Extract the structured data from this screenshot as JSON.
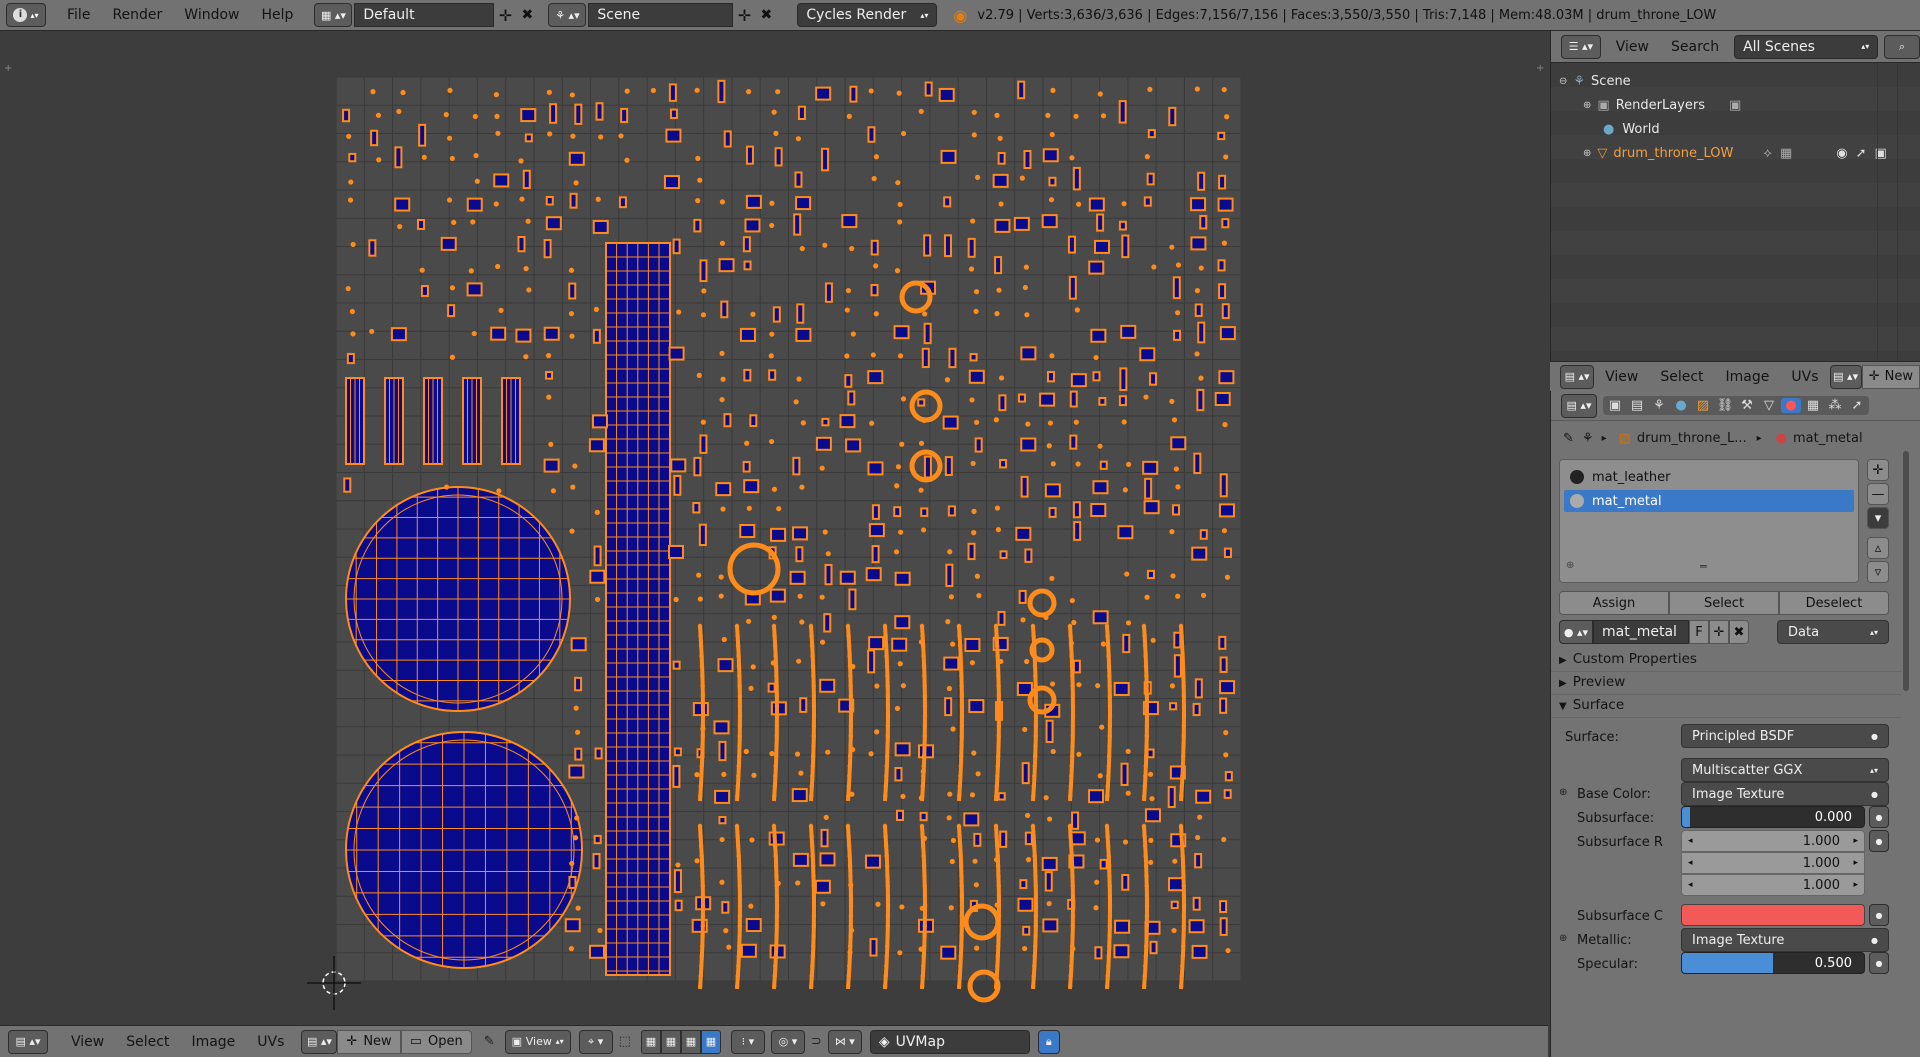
{
  "topbar": {
    "menus": [
      "File",
      "Render",
      "Window",
      "Help"
    ],
    "screen_layout": "Default",
    "scene": "Scene",
    "render_engine": "Cycles Render",
    "stats": "v2.79 | Verts:3,636/3,636 | Edges:7,156/7,156 | Faces:3,550/3,550 | Tris:7,148 | Mem:48.03M | drum_throne_LOW"
  },
  "outliner": {
    "menus": [
      "View",
      "Search"
    ],
    "display_mode": "All Scenes",
    "tree": [
      "Scene",
      "RenderLayers",
      "World",
      "drum_throne_LOW"
    ]
  },
  "image_header": {
    "menus": [
      "View",
      "Select",
      "Image",
      "UVs"
    ],
    "new_label": "New"
  },
  "properties": {
    "breadcrumb": {
      "object": "drum_throne_L...",
      "material": "mat_metal"
    },
    "slots": [
      "mat_leather",
      "mat_metal"
    ],
    "selected_slot": "mat_metal",
    "slot_buttons": [
      "Assign",
      "Select",
      "Deselect"
    ],
    "material_name": "mat_metal",
    "fake_user": "F",
    "link": "Data",
    "panels": [
      "Custom Properties",
      "Preview",
      "Surface"
    ],
    "surface": {
      "surface_label": "Surface:",
      "surface_value": "Principled BSDF",
      "distribution": "Multiscatter GGX",
      "base_color_label": "Base Color:",
      "base_color_value": "Image Texture",
      "subsurface_label": "Subsurface:",
      "subsurface_value": "0.000",
      "subsurface_r_label": "Subsurface R",
      "subsurface_r_values": [
        "1.000",
        "1.000",
        "1.000"
      ],
      "subsurface_c_label": "Subsurface C",
      "subsurface_c_color": "#f25a57",
      "metallic_label": "Metallic:",
      "metallic_value": "Image Texture",
      "specular_label": "Specular:",
      "specular_value": "0.500",
      "specular_fraction": 0.5
    }
  },
  "bottombar": {
    "menus": [
      "View",
      "Select",
      "Image",
      "UVs"
    ],
    "new_label": "New",
    "open_label": "Open",
    "view_label": "View",
    "uv_map": "UVMap"
  },
  "colors": {
    "header": "#727272",
    "viewport_bg": "#3d3d3d",
    "uv_canvas": "#4a4a4a",
    "uv_face": "#0a0a8c",
    "uv_edge": "#ff8c1a",
    "selection": "#3a78c8"
  }
}
